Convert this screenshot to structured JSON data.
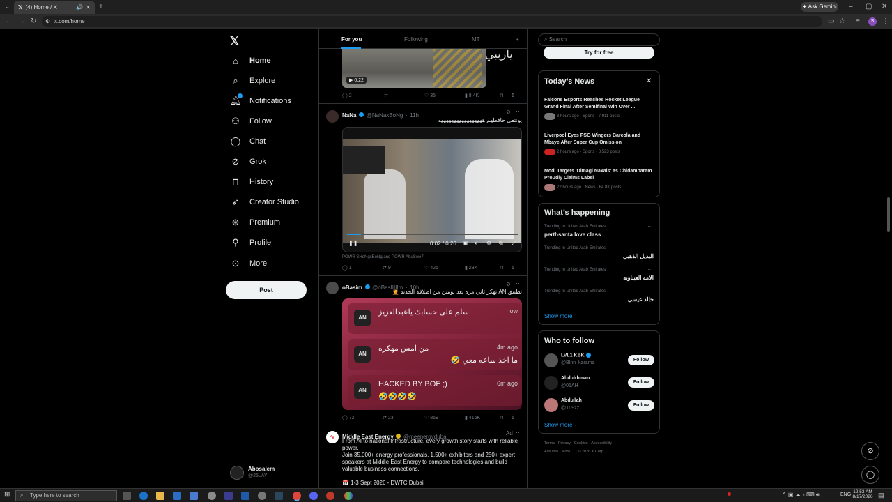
{
  "browser": {
    "tab_title": "(4) Home / X",
    "url": "x.com/home",
    "ask_gemini": "Ask Gemini"
  },
  "nav": {
    "items": [
      {
        "label": "Home",
        "icon": "home-icon"
      },
      {
        "label": "Explore",
        "icon": "search-icon"
      },
      {
        "label": "Notifications",
        "icon": "bell-icon"
      },
      {
        "label": "Follow",
        "icon": "person-plus-icon"
      },
      {
        "label": "Chat",
        "icon": "chat-icon"
      },
      {
        "label": "Grok",
        "icon": "grok-icon"
      },
      {
        "label": "History",
        "icon": "bookmark-icon"
      },
      {
        "label": "Creator Studio",
        "icon": "rocket-icon"
      },
      {
        "label": "Premium",
        "icon": "premium-icon"
      },
      {
        "label": "Profile",
        "icon": "person-icon"
      },
      {
        "label": "More",
        "icon": "more-circle-icon"
      }
    ],
    "post_label": "Post",
    "account": {
      "name": "Abosalem",
      "handle": "@25LAY_"
    }
  },
  "feed": {
    "tabs": [
      "For you",
      "Following",
      "MT"
    ],
    "tweet0": {
      "video_time": "0:22",
      "overlay_text": "يارببي",
      "stats": {
        "replies": "2",
        "reposts": "",
        "likes": "35",
        "views": "8.4K"
      }
    },
    "tweet1": {
      "name": "NaNa",
      "handle": "@NaNaxBoNg",
      "time": "11h",
      "text": "يونتقي حافظهم هههههههههههههههههه",
      "video_time": "0:02 / 0:26",
      "caption": "POWR SHoNgxBoNg and POWR AbuSwe7!",
      "stats": {
        "replies": "1",
        "reposts": "9",
        "likes": "426",
        "views": "23K"
      }
    },
    "tweet2": {
      "name": "oBasim",
      "handle": "@oBasIIIIIm",
      "time": "10h",
      "text": "تطبيق AN تهكر ثاني مره بعد يومين من اطلاقه الجديد 🤦",
      "notifications": [
        {
          "app": "AN",
          "title": "سلم على حسابك ياعبدالعزيز",
          "time": "now",
          "body": ""
        },
        {
          "app": "AN",
          "title": "من امس مهكره",
          "time": "4m ago",
          "body": "ما اخذ ساعه معي 🤣"
        },
        {
          "app": "AN",
          "title": "HACKED BY BOF ;)",
          "time": "6m ago",
          "body": "🤣🤣🤣🤣"
        }
      ],
      "stats": {
        "replies": "72",
        "reposts": "23",
        "likes": "869",
        "views": "416K"
      }
    },
    "tweet3": {
      "name": "Middle East Energy",
      "handle": "@meenergydubai",
      "ad": "Ad",
      "line1": "From AI to national infrastructure, every growth story starts with reliable power.",
      "line2": "Join 35,000+ energy professionals, 1,500+ exhibitors and 250+ expert speakers at Middle East Energy to compare technologies and build valuable business connections.",
      "line3": "📅 1-3 Sept 2026 - DWTC Dubai"
    }
  },
  "right": {
    "search_placeholder": "Search",
    "try_free": "Try for free",
    "news": {
      "title": "Today’s News",
      "items": [
        {
          "title": "Falcons Esports Reaches Rocket League Grand Final After Semifinal Win Over ...",
          "meta": "3 hours ago · Sports · 7,911 posts"
        },
        {
          "title": "Liverpool Eyes PSG Wingers Barcola and Mbaye After Super Cup Omission",
          "meta": "2 hours ago · Sports · 8,523 posts"
        },
        {
          "title": "Modi Targets 'Dimagi Naxals' as Chidambaram Proudly Claims Label",
          "meta": "22 hours ago · News · 64.8K posts"
        }
      ]
    },
    "happening": {
      "title": "What’s happening",
      "trends": [
        {
          "context": "Trending in United Arab Emirates",
          "name": "perthsanta love class"
        },
        {
          "context": "Trending in United Arab Emirates",
          "name": "البديل الذهبي"
        },
        {
          "context": "Trending in United Arab Emirates",
          "name": "الامه العيناويه"
        },
        {
          "context": "Trending in United Arab Emirates",
          "name": "خالد عيسى"
        }
      ],
      "show_more": "Show more"
    },
    "who_to_follow": {
      "title": "Who to follow",
      "accounts": [
        {
          "name": "LVL1 KBK",
          "handle": "@Blnn_karama"
        },
        {
          "name": "Abdulrhman",
          "handle": "@01AH_"
        },
        {
          "name": "Abdullah",
          "handle": "@T09zz"
        }
      ],
      "follow_label": "Follow",
      "show_more": "Show more"
    },
    "footer": {
      "row1": [
        "Terms",
        "Privacy",
        "Cookies",
        "Accessibility"
      ],
      "row2": [
        "Ads info",
        "More ...",
        "© 2026 X Corp."
      ]
    }
  },
  "taskbar": {
    "search_placeholder": "Type here to search",
    "time": "12:53 AM",
    "date": "8/17/2026",
    "lang": "ENG"
  }
}
